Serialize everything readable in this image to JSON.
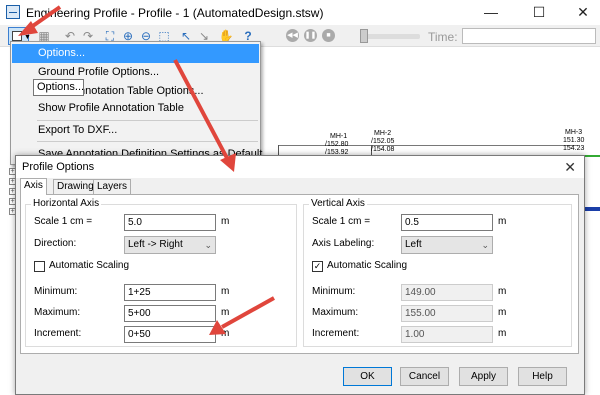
{
  "window": {
    "title": "Engineering Profile - Profile - 1 (AutomatedDesign.stsw)",
    "minimize_glyph": "—",
    "maximize_glyph": "☐",
    "close_glyph": "✕"
  },
  "toolbar": {
    "time_label": "Time:",
    "time_value": "",
    "icons": [
      "options-menu-icon",
      "undo-icon",
      "redo-icon",
      "zoom-extents-icon",
      "zoom-in-icon",
      "zoom-out-icon",
      "zoom-window-icon",
      "zoom-previous-icon",
      "zoom-next-icon",
      "pan-icon",
      "help-icon",
      "play-icon",
      "pause-icon",
      "stop-icon",
      "time-slider-icon"
    ]
  },
  "menu": {
    "items": [
      {
        "label": "Options...",
        "active": true
      },
      {
        "label": "Ground Profile Options...",
        "active": false
      },
      {
        "label": "Profile Annotation Table Options...",
        "active": false
      },
      {
        "label": "Show Profile Annotation Table",
        "active": false
      },
      {
        "label": "Export To DXF...",
        "active": false
      },
      {
        "label": "Save Annotation Definition Settings as Default",
        "active": false
      }
    ],
    "tooltip": "Options..."
  },
  "profile": {
    "stations": [
      {
        "name": "MH-1",
        "values": [
          "152.80",
          "153.92"
        ]
      },
      {
        "name": "MH-2",
        "values": [
          "152.05",
          "154.08"
        ]
      },
      {
        "name": "MH-3",
        "values": [
          "151.30",
          "154.23"
        ]
      }
    ]
  },
  "dialog": {
    "title": "Profile Options",
    "close_glyph": "✕",
    "tabs": [
      "Axis",
      "Drawing",
      "Layers"
    ],
    "active_tab": "Axis",
    "horizontal": {
      "title": "Horizontal Axis",
      "scale_label": "Scale 1 cm =",
      "scale_value": "5.0",
      "scale_unit": "m",
      "direction_label": "Direction:",
      "direction_value": "Left -> Right",
      "auto_label": "Automatic Scaling",
      "auto_checked": false,
      "min_label": "Minimum:",
      "min_value": "1+25",
      "min_unit": "m",
      "max_label": "Maximum:",
      "max_value": "5+00",
      "max_unit": "m",
      "inc_label": "Increment:",
      "inc_value": "0+50",
      "inc_unit": "m"
    },
    "vertical": {
      "title": "Vertical Axis",
      "scale_label": "Scale 1 cm =",
      "scale_value": "0.5",
      "scale_unit": "m",
      "labeling_label": "Axis Labeling:",
      "labeling_value": "Left",
      "auto_label": "Automatic Scaling",
      "auto_checked": true,
      "min_label": "Minimum:",
      "min_value": "149.00",
      "min_unit": "m",
      "max_label": "Maximum:",
      "max_value": "155.00",
      "max_unit": "m",
      "inc_label": "Increment:",
      "inc_value": "1.00",
      "inc_unit": "m"
    },
    "buttons": {
      "ok": "OK",
      "cancel": "Cancel",
      "apply": "Apply",
      "help": "Help"
    }
  },
  "colors": {
    "annotation_arrow": "#e0463c",
    "menu_highlight": "#3399ff",
    "profile_line": "#33aa33"
  }
}
